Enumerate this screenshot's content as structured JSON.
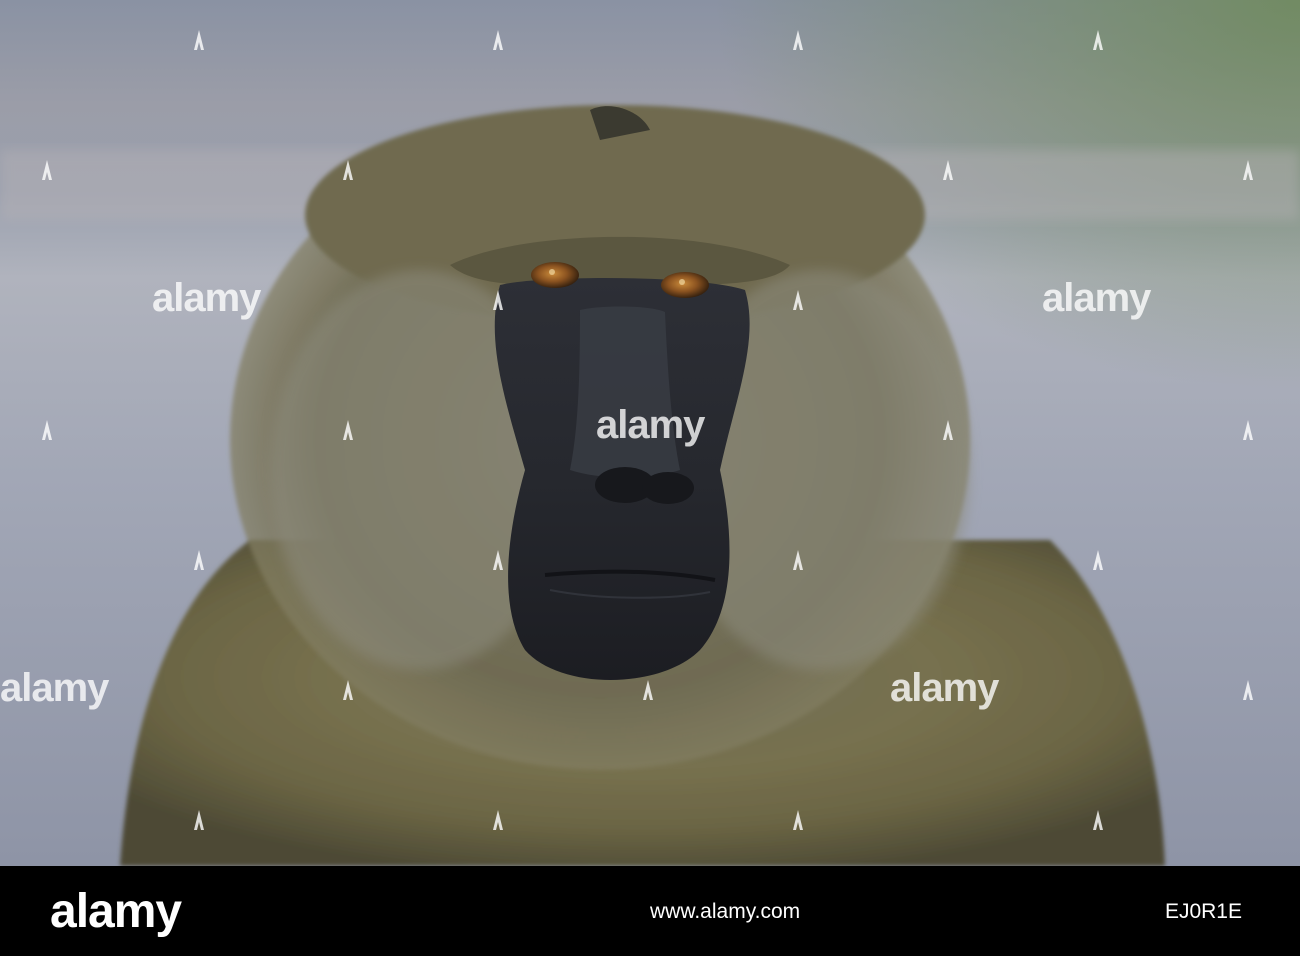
{
  "watermark": {
    "text": "alamy",
    "icon": "alamy-a-icon"
  },
  "footer": {
    "logo": "alamy",
    "url": "www.alamy.com",
    "image_id": "EJ0R1E"
  },
  "colors": {
    "footer_bg": "#000000",
    "watermark": "#ffffff"
  }
}
